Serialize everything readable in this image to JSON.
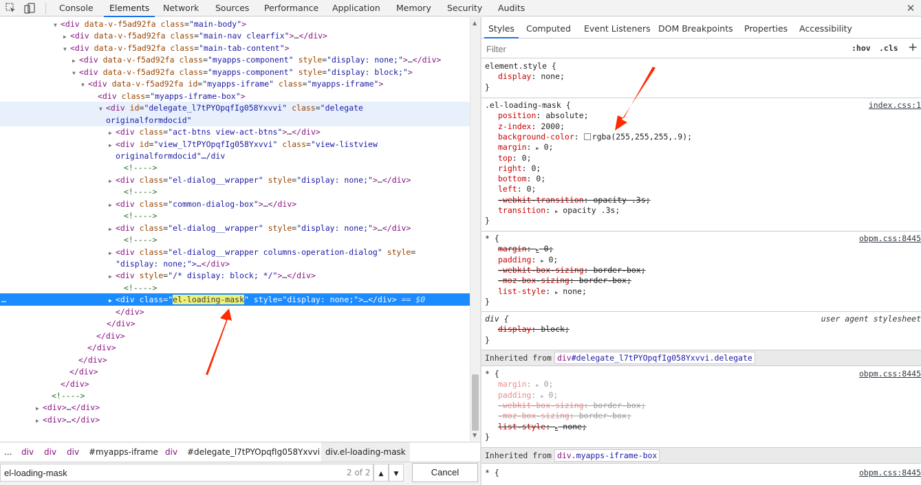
{
  "toolbar": {
    "tabs": [
      "Console",
      "Elements",
      "Network",
      "Sources",
      "Performance",
      "Application",
      "Memory",
      "Security",
      "Audits"
    ],
    "active_tab": "Elements",
    "close": "✕"
  },
  "dom_tree": {
    "lines": [
      {
        "t": "div data-v-f5ad92fa class=\"main-body\""
      },
      {
        "t": "div data-v-f5ad92fa class=\"main-nav clearfix\"…/div"
      },
      {
        "t": "div data-v-f5ad92fa class=\"main-tab-content\""
      },
      {
        "t": "div data-v-f5ad92fa class=\"myapps-component\" style=\"display: none;\"…/div"
      },
      {
        "t": "div data-v-f5ad92fa class=\"myapps-component\" style=\"display: block;\""
      },
      {
        "t": "div data-v-f5ad92fa id=\"myapps-iframe\" class=\"myapps-iframe\""
      },
      {
        "t": "div class=\"myapps-iframe-box\""
      },
      {
        "t": "div id=\"delegate_l7tPYOpqfIg058Yxvvi\" class=\"delegate"
      },
      {
        "t": "originalformdocid\""
      },
      {
        "t": "div class=\"act-btns view-act-btns\"…/div"
      },
      {
        "t": "div id=\"view_l7tPYOpqfIg058Yxvvi\" class=\"view-listview"
      },
      {
        "t": "originalformdocid\"…/div"
      },
      {
        "t": "!---->"
      },
      {
        "t": "div class=\"el-dialog__wrapper\" style=\"display: none;\"…/div"
      },
      {
        "t": "!---->"
      },
      {
        "t": "div class=\"common-dialog-box\"…/div"
      },
      {
        "t": "!---->"
      },
      {
        "t": "div class=\"el-dialog__wrapper\" style=\"display: none;\"…/div"
      },
      {
        "t": "!---->"
      },
      {
        "t": "div class=\"el-dialog__wrapper columns-operation-dialog\" style="
      },
      {
        "t": "\"display: none;\"…/div"
      },
      {
        "t": "div style=\"/* display: block; */\"…/div"
      },
      {
        "t": "!---->"
      },
      {
        "t": "div class=\"el-loading-mask\" style=\"display: none;\"…/div == $0"
      },
      {
        "t": "/div"
      },
      {
        "t": "/div"
      },
      {
        "t": "/div"
      },
      {
        "t": "/div"
      },
      {
        "t": "/div"
      },
      {
        "t": "/div"
      },
      {
        "t": "/div"
      },
      {
        "t": "!---->"
      },
      {
        "t": "div…/div"
      },
      {
        "t": "div…/div"
      }
    ],
    "selected_ellipsis": "…",
    "highlight_match": "el-loading-mask"
  },
  "breadcrumb": {
    "items": [
      "...",
      "div",
      "div",
      "div",
      "#myapps-iframe",
      "div",
      "#delegate_l7tPYOpqfIg058Yxvvi",
      "div.el-loading-mask"
    ]
  },
  "search": {
    "value": "el-loading-mask",
    "count": "2 of 2",
    "up": "▲",
    "down": "▼",
    "cancel": "Cancel"
  },
  "styles": {
    "tabs": [
      "Styles",
      "Computed",
      "Event Listeners",
      "DOM Breakpoints",
      "Properties",
      "Accessibility"
    ],
    "active_tab": "Styles",
    "filter_placeholder": "Filter",
    "hov": ":hov",
    "cls": ".cls",
    "plus": "+",
    "element_style": {
      "selector": "element.style {",
      "decls": [
        {
          "p": "display",
          "v": "none;"
        }
      ],
      "close": "}"
    },
    "loading_mask": {
      "selector": ".el-loading-mask {",
      "source": "index.css:1",
      "decls": [
        {
          "p": "position",
          "v": "absolute;"
        },
        {
          "p": "z-index",
          "v": "2000;"
        },
        {
          "p": "background-color",
          "v": "rgba(255,255,255,.9);",
          "swatch": "#ffffff"
        },
        {
          "p": "margin",
          "v": "0;",
          "exp": true
        },
        {
          "p": "top",
          "v": "0;"
        },
        {
          "p": "right",
          "v": "0;"
        },
        {
          "p": "bottom",
          "v": "0;"
        },
        {
          "p": "left",
          "v": "0;"
        },
        {
          "p": "-webkit-transition",
          "v": "opacity .3s;",
          "struck": true
        },
        {
          "p": "transition",
          "v": "opacity .3s;",
          "exp": true
        }
      ],
      "close": "}"
    },
    "star_rule": {
      "selector": "* {",
      "source": "obpm.css:8445",
      "decls": [
        {
          "p": "margin",
          "v": "0;",
          "exp": true,
          "struck": true
        },
        {
          "p": "padding",
          "v": "0;",
          "exp": true
        },
        {
          "p": "-webkit-box-sizing",
          "v": "border-box;",
          "struck": true
        },
        {
          "p": "-moz-box-sizing",
          "v": "border-box;",
          "struck": true
        },
        {
          "p": "list-style",
          "v": "none;",
          "exp": true
        }
      ],
      "close": "}"
    },
    "ua_rule": {
      "selector": "div {",
      "source": "user agent stylesheet",
      "decls": [
        {
          "p": "display",
          "v": "block;",
          "struck": true
        }
      ],
      "close": "}"
    },
    "inherited1": {
      "label": "Inherited from",
      "tag": "div",
      "id": "#delegate_l7tPYOpqfIg058Yxvvi",
      "cls": ".delegate"
    },
    "star_rule2": {
      "selector": "* {",
      "source": "obpm.css:8445",
      "decls": [
        {
          "p": "margin",
          "v": "0;",
          "exp": true,
          "faded": true
        },
        {
          "p": "padding",
          "v": "0;",
          "exp": true,
          "faded": true
        },
        {
          "p": "-webkit-box-sizing",
          "v": "border-box;",
          "struck": true,
          "faded": true
        },
        {
          "p": "-moz-box-sizing",
          "v": "border-box;",
          "struck": true,
          "faded": true
        },
        {
          "p": "list-style",
          "v": "none;",
          "exp": true,
          "struck": true
        }
      ],
      "close": "}"
    },
    "inherited2": {
      "label": "Inherited from",
      "tag": "div",
      "cls": ".myapps-iframe-box"
    },
    "star_rule3": {
      "selector": "* {",
      "source": "obpm.css:8445"
    }
  },
  "annotation_color": "#ff2a00"
}
